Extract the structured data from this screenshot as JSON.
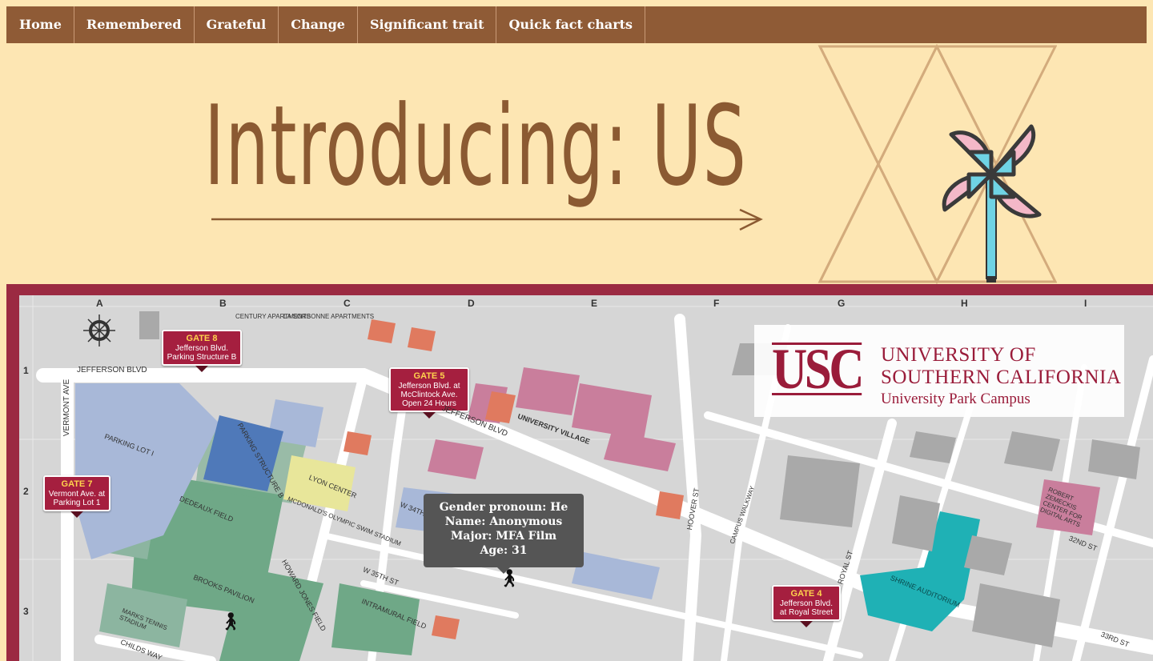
{
  "nav": {
    "items": [
      {
        "label": "Home"
      },
      {
        "label": "Remembered"
      },
      {
        "label": "Grateful"
      },
      {
        "label": "Change"
      },
      {
        "label": "Significant trait"
      },
      {
        "label": "Quick fact charts"
      }
    ]
  },
  "hero": {
    "title": "Introducing: US"
  },
  "map": {
    "brand": {
      "logo": "USC",
      "line1": "UNIVERSITY OF",
      "line2": "SOUTHERN CALIFORNIA",
      "line3": "University Park Campus"
    },
    "columns": [
      "A",
      "B",
      "C",
      "D",
      "E",
      "F",
      "G",
      "H",
      "I"
    ],
    "rows": [
      "1",
      "2",
      "3"
    ],
    "gates": [
      {
        "title": "GATE 8",
        "desc": "Jefferson Blvd. Parking Structure B"
      },
      {
        "title": "GATE 5",
        "desc": "Jefferson Blvd. at McClintock Ave. Open 24 Hours"
      },
      {
        "title": "GATE 7",
        "desc": "Vermont Ave. at Parking Lot 1"
      },
      {
        "title": "GATE 4",
        "desc": "Jefferson Blvd. at Royal Street"
      }
    ],
    "labels": {
      "jefferson": "JEFFERSON BLVD",
      "jefferson2": "JEFFERSON BLVD",
      "vermont": "VERMONT AVE",
      "parking1": "PARKING LOT I",
      "parkingB": "PARKING STRUCTURE B",
      "dedeaux": "DEDEAUX FIELD",
      "lyon": "LYON CENTER",
      "mcdonalds": "MCDONALD'S OLYMPIC SWIM STADIUM",
      "univvillage": "UNIVERSITY VILLAGE",
      "hoover": "HOOVER ST",
      "shrine": "SHRINE AUDITORIUM",
      "w35": "W 35TH ST",
      "w34": "W 34TH",
      "brooks": "BROOKS PAVILION",
      "howard": "HOWARD JONES FIELD",
      "intramural": "INTRAMURAL FIELD",
      "royal": "ROYAL ST",
      "st32": "32ND ST",
      "st33": "33RD ST",
      "century": "CENTURY APARTMENTS",
      "sorbonne": "LA SORBONNE APARTMENTS",
      "zemeckis": "ROBERT ZEMECKIS CENTER FOR DIGITAL ARTS",
      "campuswalk": "CAMPUS WALKWAY",
      "marks": "MARKS TENNIS STADIUM",
      "childs": "CHILDS WAY"
    },
    "icons": [
      "compass-icon",
      "person-icon",
      "parking-icon"
    ]
  },
  "tooltip": {
    "pronoun": "Gender pronoun: He",
    "name": "Name: Anonymous",
    "major": "Major: MFA Film",
    "age": "Age: 31"
  }
}
